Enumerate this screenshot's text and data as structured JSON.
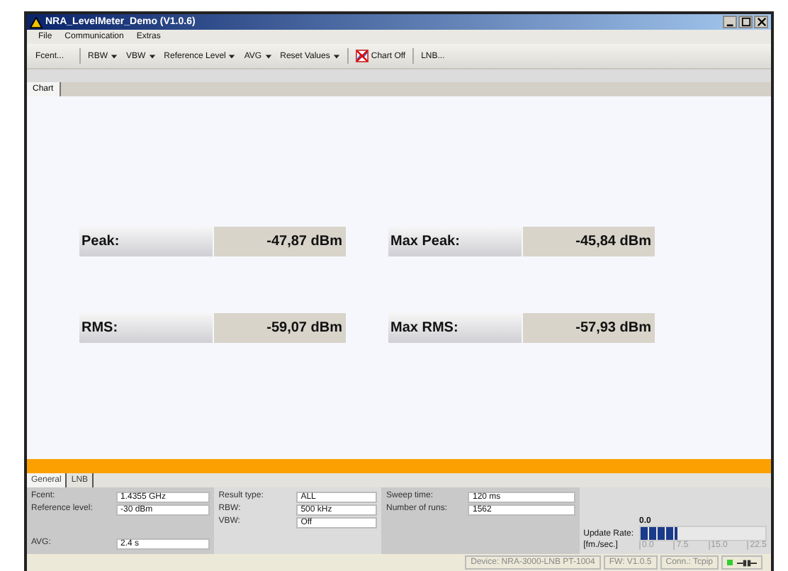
{
  "window": {
    "title": "NRA_LevelMeter_Demo (V1.0.6)"
  },
  "menu": [
    "File",
    "Communication",
    "Extras"
  ],
  "toolbar": [
    {
      "label": "Fcent...",
      "kind": "button"
    },
    {
      "label": "RBW",
      "kind": "dropdown"
    },
    {
      "label": "VBW",
      "kind": "dropdown"
    },
    {
      "label": "Reference Level",
      "kind": "dropdown"
    },
    {
      "label": "AVG",
      "kind": "dropdown"
    },
    {
      "label": "Reset Values",
      "kind": "dropdown"
    },
    {
      "label": "Chart Off",
      "kind": "icon-button"
    },
    {
      "label": "LNB...",
      "kind": "button"
    }
  ],
  "view_tabs": [
    {
      "label": "Chart",
      "selected": true
    }
  ],
  "readings": [
    {
      "label": "Peak:",
      "value": "-47,87 dBm"
    },
    {
      "label": "Max Peak:",
      "value": "-45,84 dBm"
    },
    {
      "label": "RMS:",
      "value": "-59,07 dBm"
    },
    {
      "label": "Max RMS:",
      "value": "-57,93 dBm"
    }
  ],
  "panel_tabs": [
    {
      "label": "General",
      "selected": true
    },
    {
      "label": "LNB",
      "selected": false
    }
  ],
  "groups": [
    [
      {
        "label": "Fcent:",
        "value": "1.4355 GHz"
      },
      {
        "label": "Reference level:",
        "value": "-30 dBm"
      },
      {
        "label": "AVG:",
        "value": "2.4 s"
      }
    ],
    [
      {
        "label": "Result type:",
        "value": "ALL"
      },
      {
        "label": "RBW:",
        "value": "500 kHz"
      },
      {
        "label": "VBW:",
        "value": "Off"
      }
    ],
    [
      {
        "label": "Sweep time:",
        "value": "120 ms"
      },
      {
        "label": "Number of runs:",
        "value": "1562"
      }
    ]
  ],
  "update_rate": {
    "value": "0.0",
    "label": "Update Rate:",
    "unit": "[fm./sec.]",
    "level": 0.3,
    "ticks": [
      "0.0",
      "7.5",
      "15.0",
      "22.5"
    ]
  },
  "status_bar": {
    "device": "Device: NRA-3000-LNB PT-1004",
    "firmware": "FW: V1.0.5",
    "connection": "Conn.: Tcpip",
    "connected": true
  }
}
